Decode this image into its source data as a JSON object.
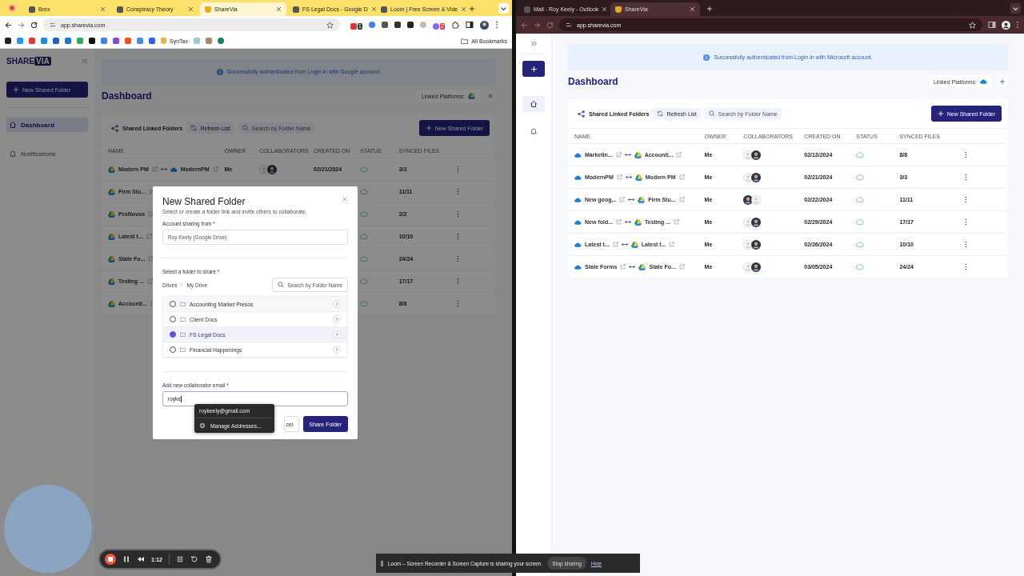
{
  "left_window": {
    "tabs": [
      {
        "title": "Brex",
        "selected": false
      },
      {
        "title": "Conspiracy Theory",
        "selected": false
      },
      {
        "title": "ShareVia",
        "selected": true
      },
      {
        "title": "FS Legal Docs - Google D",
        "selected": false
      },
      {
        "title": "Loom | Free Screen & Vide",
        "selected": false
      }
    ],
    "url": "app.sharevia.com",
    "extension_badges": [
      "1",
      "2"
    ],
    "bookmarks": [
      "SynTax"
    ],
    "all_bookmarks": "All Bookmarks"
  },
  "left_app": {
    "logo": [
      "SHARE",
      "VIA"
    ],
    "sidebar_button": "New Shared Folder",
    "nav": [
      {
        "label": "Dashboard",
        "kind": "home",
        "selected": true
      },
      {
        "label": "Notifications",
        "kind": "bell",
        "selected": false
      }
    ],
    "banner": "Successfully authenticated from Login in with Google account.",
    "title": "Dashboard",
    "linked_label": "Linked Platforms:",
    "linked_platform": {
      "kind": "gdrive"
    },
    "card_title": "Shared Linked Folders",
    "refresh": "Refresh List",
    "search_placeholder": "Search by Folder Name",
    "new_button": "New Shared Folder",
    "columns": [
      "NAME",
      "OWNER",
      "COLLABORATORS",
      "CREATED ON",
      "STATUS",
      "SYNCED FILES"
    ],
    "rows": [
      {
        "source": {
          "name": "Modern PM",
          "kind": "gdrive"
        },
        "target": {
          "name": "ModernPM",
          "kind": "onedrive"
        },
        "owner": "Me",
        "collaborators": [
          {
            "kind": "blank"
          },
          {
            "kind": "photo"
          }
        ],
        "created": "02/21/2024",
        "synced": "3/3"
      },
      {
        "source": {
          "name": "Firm Stu...",
          "kind": "gdrive"
        },
        "synced": "11/11"
      },
      {
        "source": {
          "name": "ProNovos",
          "kind": "gdrive"
        },
        "synced": "2/2"
      },
      {
        "source": {
          "name": "Latest t...",
          "kind": "gdrive"
        },
        "synced": "10/10"
      },
      {
        "source": {
          "name": "State Fo...",
          "kind": "gdrive"
        },
        "synced": "24/24"
      },
      {
        "source": {
          "name": "Testing ...",
          "kind": "gdrive"
        },
        "synced": "17/17"
      },
      {
        "source": {
          "name": "Accounti...",
          "kind": "gdrive"
        },
        "synced": "8/8"
      }
    ]
  },
  "modal": {
    "title": "New Shared Folder",
    "subtitle": "Select or create a folder link and invite others to collaborate.",
    "account_label": "Account sharing from *",
    "account_value": "Roy Keely (Google Drive)",
    "folder_label": "Select a folder to share *",
    "breadcrumb": [
      "Drives",
      "My Drive"
    ],
    "search_placeholder": "Search by Folder Name",
    "folders": [
      {
        "name": "Accounting Market Presos",
        "selected": false
      },
      {
        "name": "Client Docs",
        "selected": false
      },
      {
        "name": "FS Legal Docs",
        "selected": true
      },
      {
        "name": "Financial Happenings",
        "selected": false
      }
    ],
    "email_label": "Add new collaborator email *",
    "email_value": "royke",
    "cancel_button": "cel",
    "share_button": "Share Folder",
    "autocomplete": {
      "suggestion": "roykeely@gmail.com",
      "manage": "Manage Addresses..."
    }
  },
  "right_window": {
    "tabs": [
      {
        "title": "Mail - Roy Keely - Outlook",
        "selected": false
      },
      {
        "title": "ShareVia",
        "selected": true
      }
    ],
    "url": "app.sharevia.com"
  },
  "right_app": {
    "nav": [
      {
        "kind": "home",
        "selected": true
      },
      {
        "kind": "bell",
        "selected": false
      }
    ],
    "banner": "Successfully authenticated from Login in with Microsoft account.",
    "title": "Dashboard",
    "linked_label": "Linked Platforms:",
    "linked_platform": {
      "kind": "onedrive"
    },
    "card_title": "Shared Linked Folders",
    "refresh": "Refresh List",
    "search_placeholder": "Search by Folder Name",
    "new_button": "New Shared Folder",
    "columns": [
      "NAME",
      "OWNER",
      "COLLABORATORS",
      "CREATED ON",
      "STATUS",
      "SYNCED FILES"
    ],
    "rows": [
      {
        "source": {
          "name": "Marketin...",
          "kind": "onedrive"
        },
        "target": {
          "name": "Accounti...",
          "kind": "gdrive"
        },
        "owner": "Me",
        "collaborators": [
          {
            "kind": "blank"
          },
          {
            "kind": "photo"
          }
        ],
        "created": "02/13/2024",
        "synced": "8/8"
      },
      {
        "source": {
          "name": "ModernPM",
          "kind": "onedrive"
        },
        "target": {
          "name": "Modern PM",
          "kind": "gdrive"
        },
        "owner": "Me",
        "collaborators": [
          {
            "kind": "blank"
          },
          {
            "kind": "photo"
          }
        ],
        "created": "02/21/2024",
        "synced": "3/3"
      },
      {
        "source": {
          "name": "New goog...",
          "kind": "onedrive"
        },
        "target": {
          "name": "Firm Stu...",
          "kind": "gdrive"
        },
        "owner": "Me",
        "collaborators": [
          {
            "kind": "photo"
          },
          {
            "kind": "blank"
          }
        ],
        "created": "02/22/2024",
        "synced": "11/11"
      },
      {
        "source": {
          "name": "New fold...",
          "kind": "onedrive"
        },
        "target": {
          "name": "Testing ...",
          "kind": "gdrive"
        },
        "owner": "Me",
        "collaborators": [
          {
            "kind": "blank"
          },
          {
            "kind": "photo"
          }
        ],
        "created": "02/29/2024",
        "synced": "17/17"
      },
      {
        "source": {
          "name": "Latest t...",
          "kind": "onedrive"
        },
        "target": {
          "name": "Latest t...",
          "kind": "gdrive"
        },
        "owner": "Me",
        "collaborators": [
          {
            "kind": "blank"
          },
          {
            "kind": "photo"
          }
        ],
        "created": "02/26/2024",
        "synced": "10/10"
      },
      {
        "source": {
          "name": "State Forms",
          "kind": "onedrive"
        },
        "target": {
          "name": "State Fo...",
          "kind": "gdrive"
        },
        "owner": "Me",
        "collaborators": [
          {
            "kind": "blank"
          },
          {
            "kind": "photo"
          }
        ],
        "created": "03/05/2024",
        "synced": "24/24"
      }
    ]
  },
  "loom_controls": {
    "time": "1:12"
  },
  "sharing_bar": {
    "message": "Loom – Screen Recorder & Screen Capture is sharing your screen.",
    "stop": "Stop sharing",
    "hide": "Hide"
  }
}
